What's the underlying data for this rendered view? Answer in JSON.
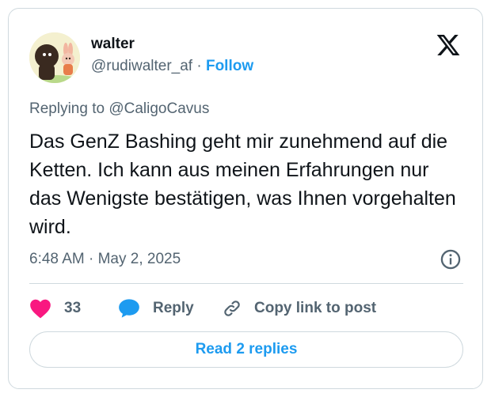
{
  "author": {
    "name": "walter",
    "handle": "@rudiwalter_af",
    "separator": "·",
    "follow_label": "Follow"
  },
  "replying_to": "Replying to @CaligoCavus",
  "tweet": {
    "text": "Das GenZ Bashing geht mir zunehmend auf die Ketten. Ich kann aus meinen Erfahrungen nur das Wenigste bestätigen, was Ihnen vorgehalten wird.",
    "timestamp": "6:48 AM · May 2, 2025"
  },
  "actions": {
    "like_count": "33",
    "reply_label": "Reply",
    "copy_link_label": "Copy link to post"
  },
  "read_replies_label": "Read 2 replies",
  "colors": {
    "accent": "#1d9bf0",
    "like": "#f91880",
    "secondary_text": "#536471",
    "border": "#cfd9de"
  },
  "icons": [
    "avatar",
    "x-logo-icon",
    "info-icon",
    "heart-icon",
    "speech-bubble-icon",
    "link-icon"
  ]
}
